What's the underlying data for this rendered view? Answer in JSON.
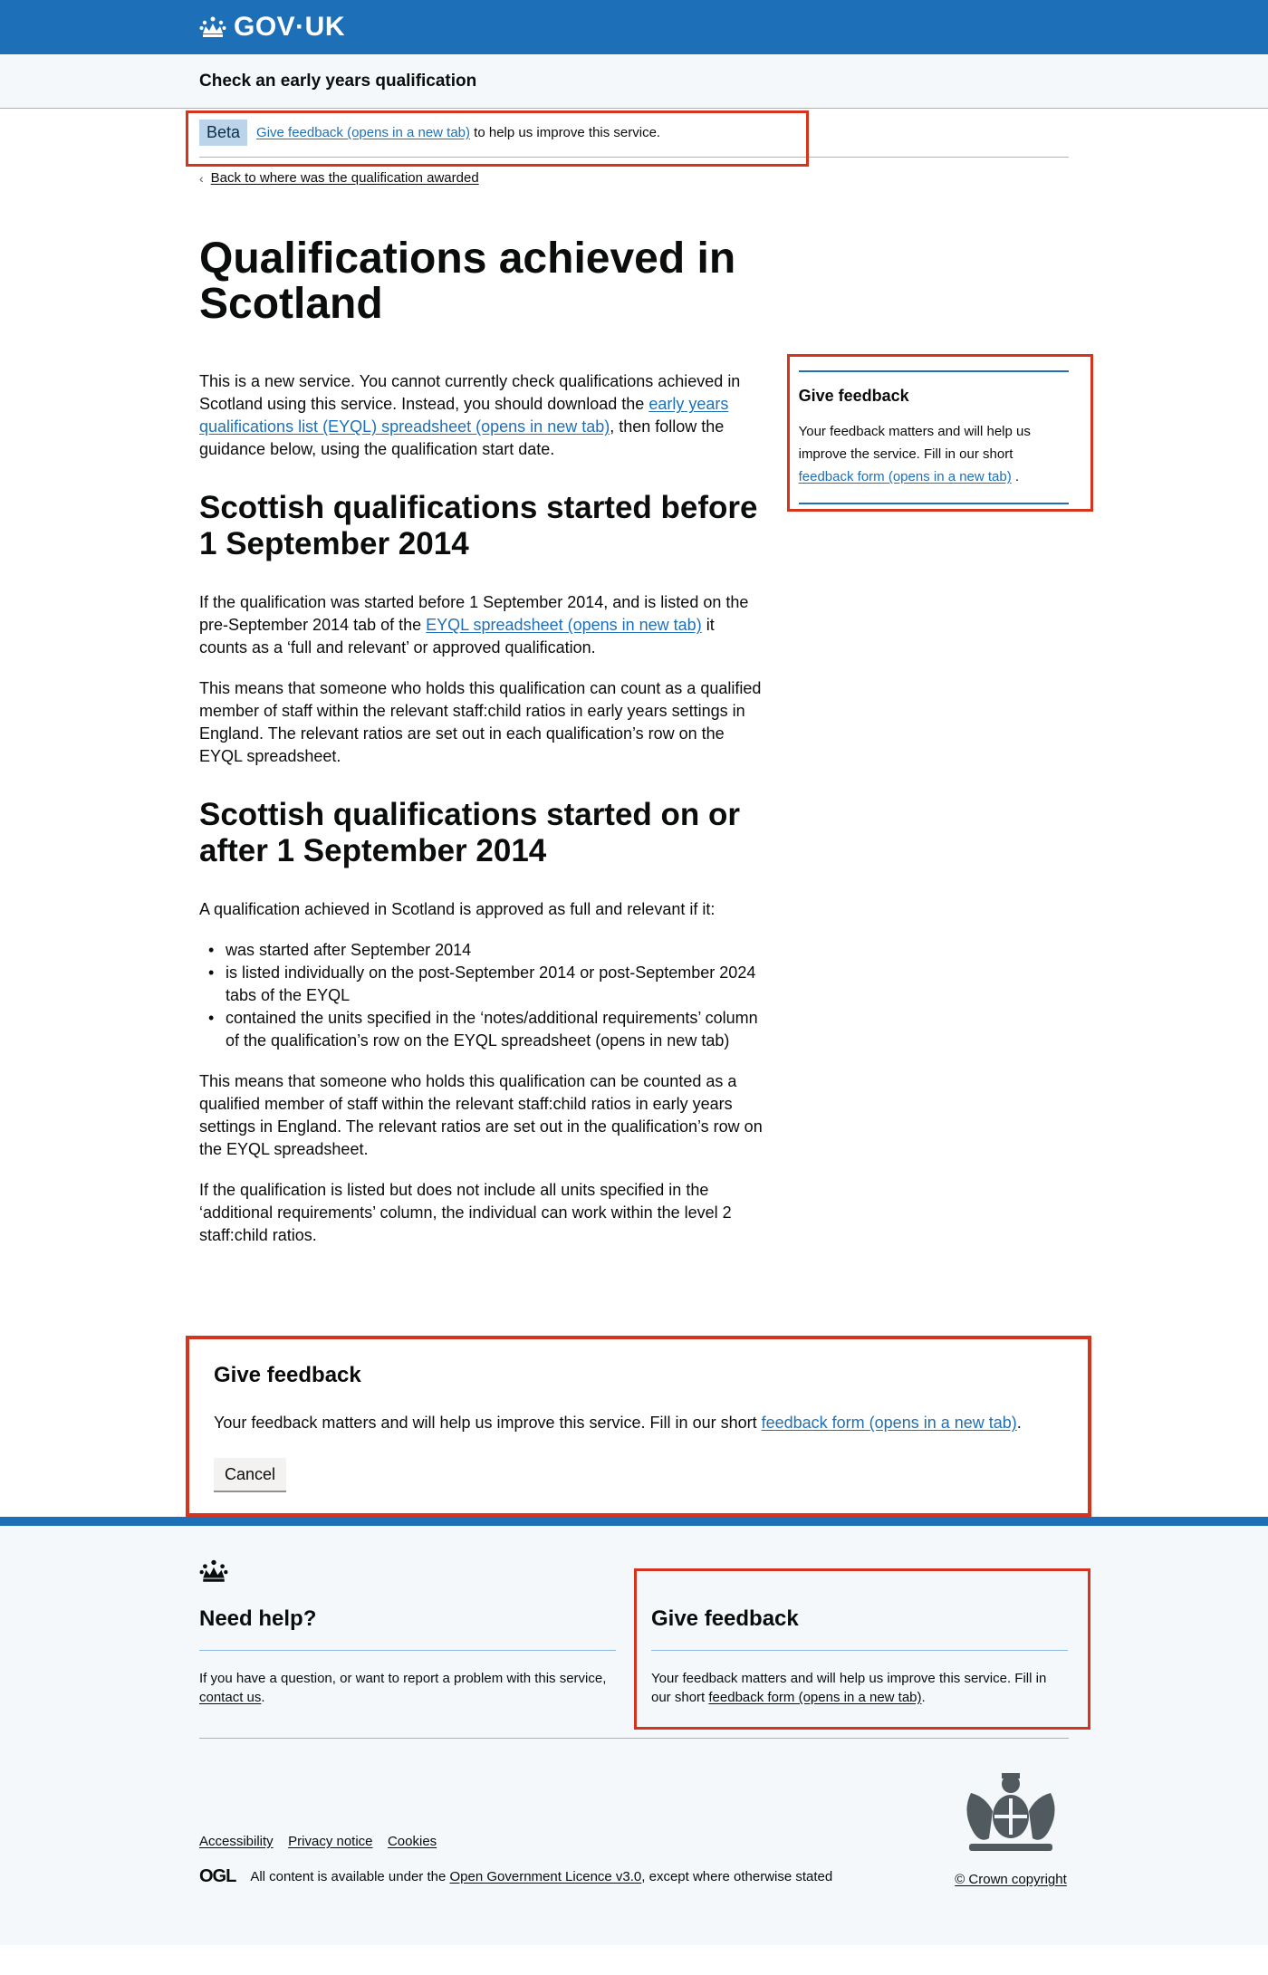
{
  "header": {
    "logo_text": "GOV·UK",
    "service_name": "Check an early years qualification"
  },
  "phase_banner": {
    "tag": "Beta",
    "link_text": "Give feedback (opens in a new tab)",
    "suffix": " to help us improve this service."
  },
  "back_link": "Back to where was the qualification awarded",
  "page_title": "Qualifications achieved in Scotland",
  "intro": {
    "before": "This is a new service. You cannot currently check qualifications achieved in Scotland using this service. Instead, you should download the ",
    "link": "early years qualifications list (EYQL) spreadsheet (opens in new tab)",
    "after": ", then follow the guidance below, using the qualification start date."
  },
  "section1": {
    "heading": "Scottish qualifications started before 1 September 2014",
    "p1_before": "If the qualification was started before 1 September 2014, and is listed on the pre-September 2014 tab of the ",
    "p1_link": "EYQL spreadsheet (opens in new tab)",
    "p1_after": " it counts as a ‘full and relevant’ or approved qualification.",
    "p2": "This means that someone who holds this qualification can count as a qualified member of staff within the relevant staff:child ratios in early years settings in England. The relevant ratios are set out in each qualification’s row on the EYQL spreadsheet."
  },
  "section2": {
    "heading": "Scottish qualifications started on or after 1 September 2014",
    "intro": "A qualification achieved in Scotland is approved as full and relevant if it:",
    "bullets": [
      "was started after September 2014",
      "is listed individually on the post-September 2014 or post-September 2024 tabs of the EYQL",
      "contained the units specified in the ‘notes/additional requirements’ column of the qualification’s row on the EYQL spreadsheet (opens in new tab)"
    ],
    "p2": "This means that someone who holds this qualification can be counted as a qualified member of staff within the relevant staff:child ratios in early years settings in England. The relevant ratios are set out in the qualification’s row on the EYQL spreadsheet.",
    "p3": "If the qualification is listed but does not include all units specified in the ‘additional requirements’ column, the individual can work within the level 2 staff:child ratios."
  },
  "sidebar_feedback": {
    "title": "Give feedback",
    "text": "Your feedback matters and will help us improve the service. Fill in our short ",
    "link": "feedback form (opens in a new tab)",
    "end": " ."
  },
  "feedback_panel": {
    "title": "Give feedback",
    "text": "Your feedback matters and will help us improve this service. Fill in our short ",
    "link": "feedback form (opens in a new tab)",
    "end": ".",
    "cancel": "Cancel"
  },
  "footer": {
    "help_title": "Need help?",
    "help_text": "If you have a question, or want to report a problem with this service, ",
    "help_link": "contact us",
    "help_end": ".",
    "feedback_title": "Give feedback",
    "feedback_text": "Your feedback matters and will help us improve this service. Fill in our short ",
    "feedback_link": "feedback form (opens in a new tab)",
    "feedback_end": ".",
    "links": [
      "Accessibility",
      "Privacy notice",
      "Cookies"
    ],
    "ogl_logo": "OGL",
    "licence_before": "All content is available under the ",
    "licence_link": "Open Government Licence v3.0",
    "licence_after": ", except where otherwise stated",
    "copyright": "© Crown copyright"
  },
  "colors": {
    "brand_blue": "#1d70b8",
    "highlight_red": "#d4351c",
    "footer_bg": "#f4f8fb"
  }
}
